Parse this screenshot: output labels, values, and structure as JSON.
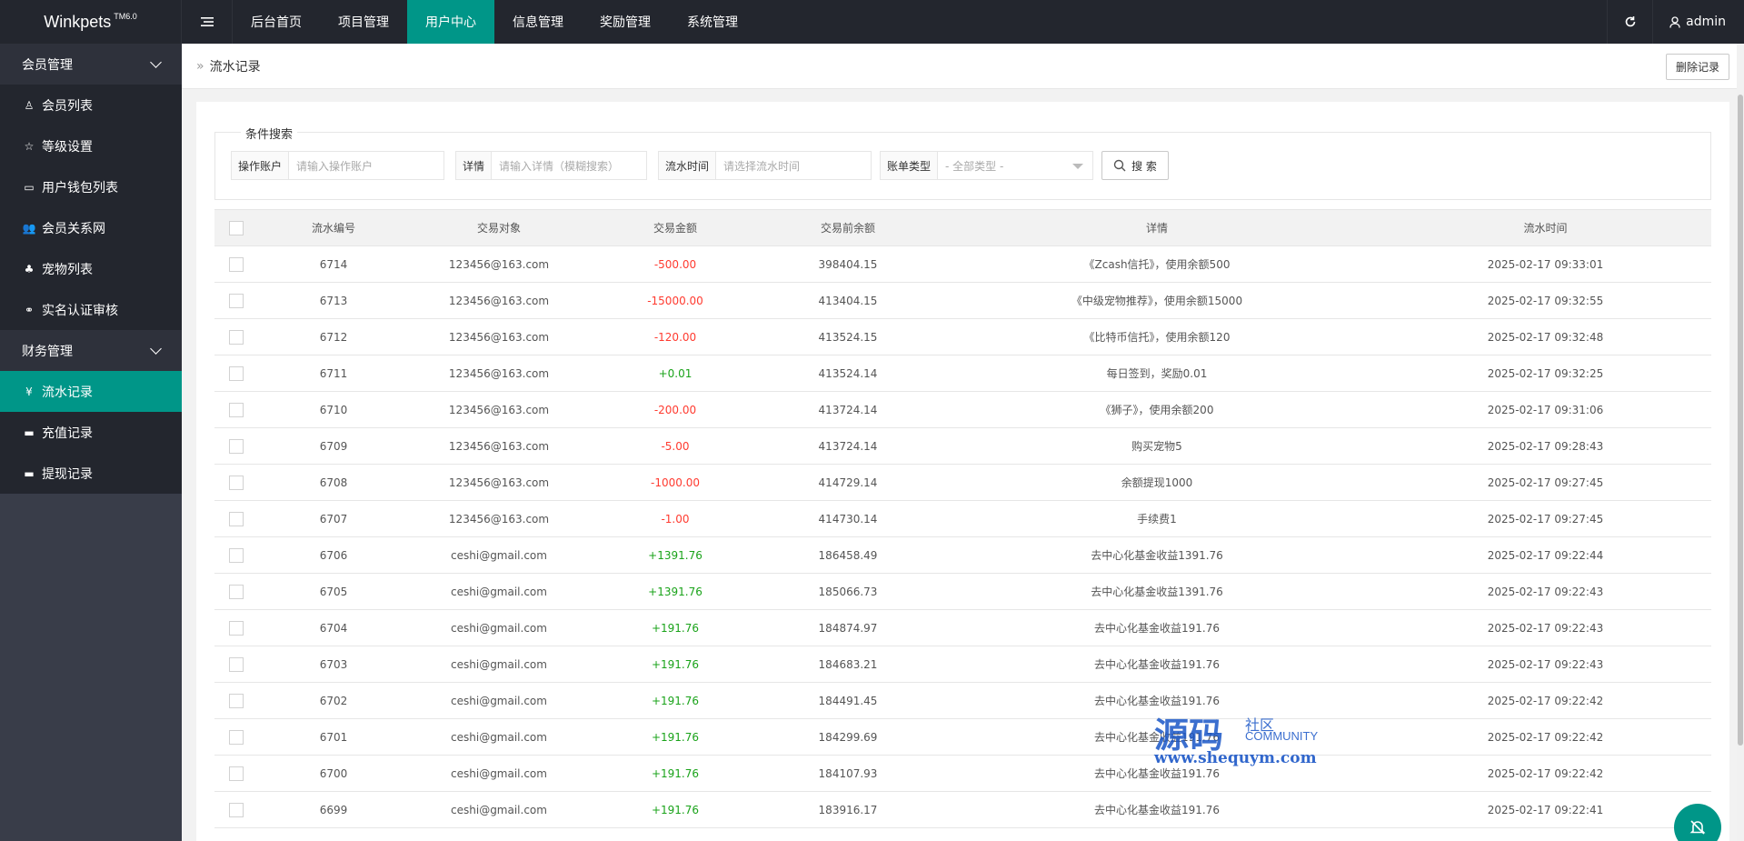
{
  "header": {
    "logo": "Winkpets",
    "logo_sup": "TM6.0",
    "nav": [
      "后台首页",
      "项目管理",
      "用户中心",
      "信息管理",
      "奖励管理",
      "系统管理"
    ],
    "active_nav": 2,
    "user": "admin"
  },
  "sidebar": {
    "groups": [
      {
        "label": "会员管理",
        "items": [
          {
            "label": "会员列表",
            "icon": "user-icon"
          },
          {
            "label": "等级设置",
            "icon": "star-icon"
          },
          {
            "label": "用户钱包列表",
            "icon": "wallet-icon"
          },
          {
            "label": "会员关系网",
            "icon": "users-icon"
          },
          {
            "label": "宠物列表",
            "icon": "pet-icon"
          },
          {
            "label": "实名认证审核",
            "icon": "link-icon"
          }
        ]
      },
      {
        "label": "财务管理",
        "items": [
          {
            "label": "流水记录",
            "icon": "yen-icon"
          },
          {
            "label": "充值记录",
            "icon": "card-icon"
          },
          {
            "label": "提现记录",
            "icon": "credit-card-icon"
          }
        ]
      }
    ],
    "active_item": "流水记录"
  },
  "breadcrumb": {
    "current": "流水记录"
  },
  "toolbar": {
    "delete_label": "删除记录"
  },
  "search": {
    "legend": "条件搜索",
    "fields": [
      {
        "label": "操作账户",
        "placeholder": "请输入操作账户"
      },
      {
        "label": "详情",
        "placeholder": "请输入详情（模糊搜索）"
      },
      {
        "label": "流水时间",
        "placeholder": "请选择流水时间"
      },
      {
        "label": "账单类型",
        "placeholder": "- 全部类型 -"
      }
    ],
    "button_label": "搜 索"
  },
  "table": {
    "columns": [
      "流水编号",
      "交易对象",
      "交易金额",
      "交易前余额",
      "详情",
      "流水时间"
    ],
    "rows": [
      {
        "id": "6714",
        "target": "123456@163.com",
        "amount": "-500.00",
        "before": "398404.15",
        "detail": "《Zcash信托》，使用余额500",
        "time": "2025-02-17 09:33:01"
      },
      {
        "id": "6713",
        "target": "123456@163.com",
        "amount": "-15000.00",
        "before": "413404.15",
        "detail": "《中级宠物推荐》，使用余额15000",
        "time": "2025-02-17 09:32:55"
      },
      {
        "id": "6712",
        "target": "123456@163.com",
        "amount": "-120.00",
        "before": "413524.15",
        "detail": "《比特币信托》，使用余额120",
        "time": "2025-02-17 09:32:48"
      },
      {
        "id": "6711",
        "target": "123456@163.com",
        "amount": "+0.01",
        "before": "413524.14",
        "detail": "每日签到，奖励0.01",
        "time": "2025-02-17 09:32:25"
      },
      {
        "id": "6710",
        "target": "123456@163.com",
        "amount": "-200.00",
        "before": "413724.14",
        "detail": "《狮子》，使用余额200",
        "time": "2025-02-17 09:31:06"
      },
      {
        "id": "6709",
        "target": "123456@163.com",
        "amount": "-5.00",
        "before": "413724.14",
        "detail": "购买宠物5",
        "time": "2025-02-17 09:28:43"
      },
      {
        "id": "6708",
        "target": "123456@163.com",
        "amount": "-1000.00",
        "before": "414729.14",
        "detail": "余额提现1000",
        "time": "2025-02-17 09:27:45"
      },
      {
        "id": "6707",
        "target": "123456@163.com",
        "amount": "-1.00",
        "before": "414730.14",
        "detail": "手续费1",
        "time": "2025-02-17 09:27:45"
      },
      {
        "id": "6706",
        "target": "ceshi@gmail.com",
        "amount": "+1391.76",
        "before": "186458.49",
        "detail": "去中心化基金收益1391.76",
        "time": "2025-02-17 09:22:44"
      },
      {
        "id": "6705",
        "target": "ceshi@gmail.com",
        "amount": "+1391.76",
        "before": "185066.73",
        "detail": "去中心化基金收益1391.76",
        "time": "2025-02-17 09:22:43"
      },
      {
        "id": "6704",
        "target": "ceshi@gmail.com",
        "amount": "+191.76",
        "before": "184874.97",
        "detail": "去中心化基金收益191.76",
        "time": "2025-02-17 09:22:43"
      },
      {
        "id": "6703",
        "target": "ceshi@gmail.com",
        "amount": "+191.76",
        "before": "184683.21",
        "detail": "去中心化基金收益191.76",
        "time": "2025-02-17 09:22:43"
      },
      {
        "id": "6702",
        "target": "ceshi@gmail.com",
        "amount": "+191.76",
        "before": "184491.45",
        "detail": "去中心化基金收益191.76",
        "time": "2025-02-17 09:22:42"
      },
      {
        "id": "6701",
        "target": "ceshi@gmail.com",
        "amount": "+191.76",
        "before": "184299.69",
        "detail": "去中心化基金收益191.76",
        "time": "2025-02-17 09:22:42"
      },
      {
        "id": "6700",
        "target": "ceshi@gmail.com",
        "amount": "+191.76",
        "before": "184107.93",
        "detail": "去中心化基金收益191.76",
        "time": "2025-02-17 09:22:42"
      },
      {
        "id": "6699",
        "target": "ceshi@gmail.com",
        "amount": "+191.76",
        "before": "183916.17",
        "detail": "去中心化基金收益191.76",
        "time": "2025-02-17 09:22:41"
      }
    ]
  },
  "watermark": {
    "big": "源码",
    "small": "社区",
    "community": "COMMUNITY",
    "url": "www.shequym.com"
  },
  "colors": {
    "accent": "#009688",
    "header": "#23262e",
    "sidebar": "#393d49",
    "negative": "#ff3b30",
    "positive": "#1aa31a"
  }
}
